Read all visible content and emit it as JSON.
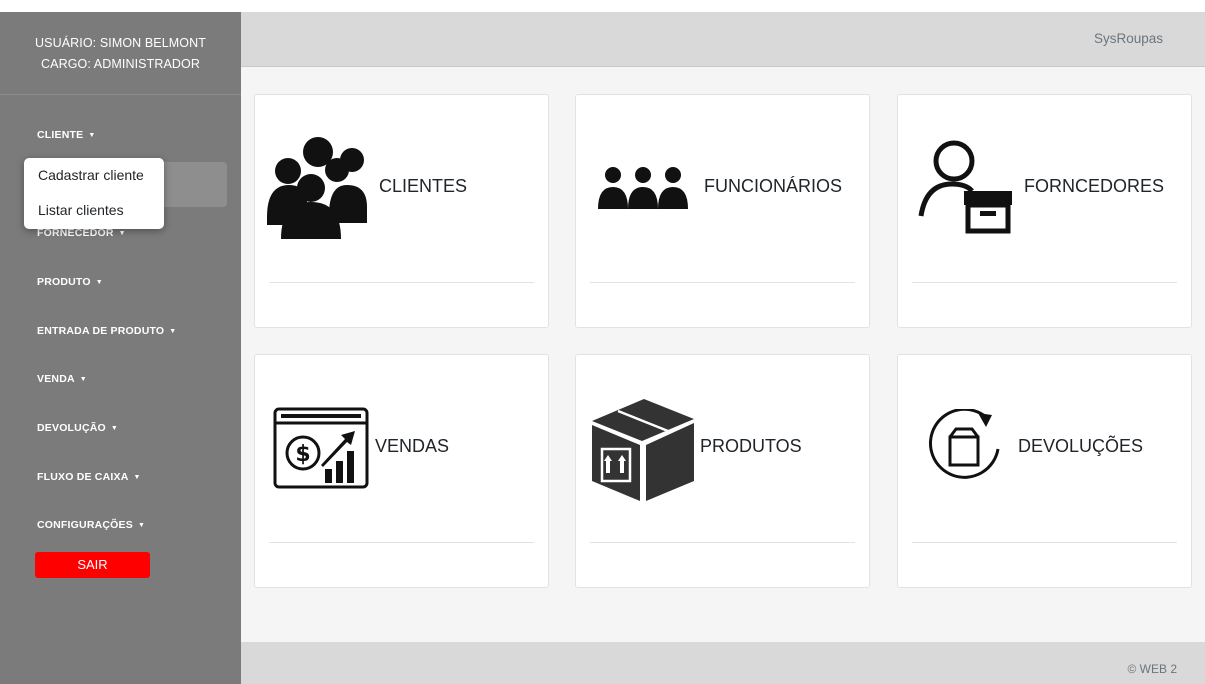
{
  "app": {
    "brand": "SysRoupas",
    "footer": "© WEB 2"
  },
  "user": {
    "name_line": "USUÁRIO: SIMON BELMONT",
    "role_line": "CARGO: ADMINISTRADOR"
  },
  "sidebar": {
    "items": [
      {
        "label": "CLIENTE"
      },
      {
        "label": "FORNECEDOR"
      },
      {
        "label": "PRODUTO"
      },
      {
        "label": "ENTRADA DE PRODUTO"
      },
      {
        "label": "VENDA"
      },
      {
        "label": "DEVOLUÇÃO"
      },
      {
        "label": "FLUXO DE CAIXA"
      },
      {
        "label": "CONFIGURAÇÕES"
      }
    ],
    "caret": "▼",
    "logout": "SAIR"
  },
  "dropdown": {
    "items": [
      {
        "label": "Cadastrar cliente"
      },
      {
        "label": "Listar clientes"
      }
    ]
  },
  "cards": [
    {
      "title": "CLIENTES",
      "icon": "people-group-icon"
    },
    {
      "title": "FUNCIONÁRIOS",
      "icon": "users-row-icon"
    },
    {
      "title": "FORNCEDORES",
      "icon": "supplier-icon"
    },
    {
      "title": "VENDAS",
      "icon": "sales-chart-icon"
    },
    {
      "title": "PRODUTOS",
      "icon": "box-icon"
    },
    {
      "title": "DEVOLUÇÕES",
      "icon": "return-box-icon"
    }
  ],
  "colors": {
    "sidebar": "#7b7b7b",
    "header": "#d9d9d9",
    "main": "#f5f5f5",
    "logout": "#ff0000"
  }
}
